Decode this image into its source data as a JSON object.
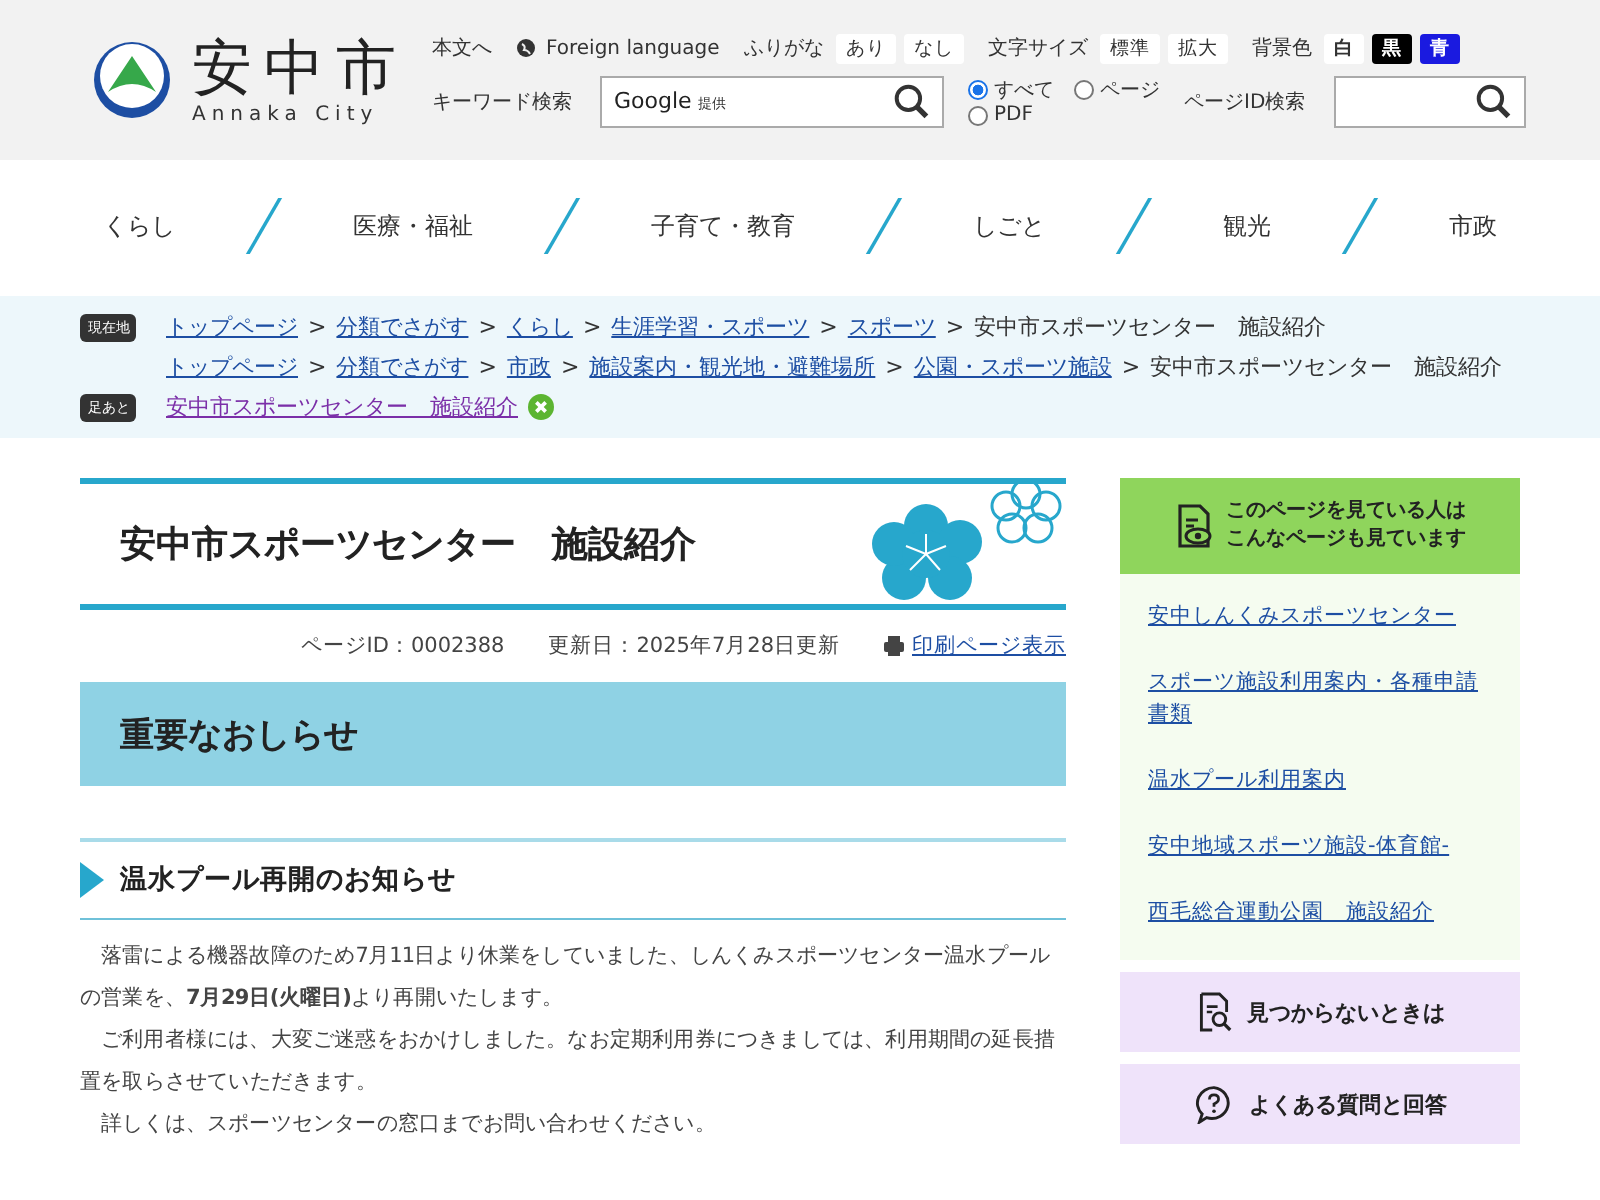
{
  "header": {
    "logo": {
      "name": "安中市",
      "sub": "Annaka City"
    },
    "skip_link": "本文へ",
    "foreign_language": "Foreign language",
    "furigana": {
      "label": "ふりがな",
      "options": [
        {
          "label": "あり",
          "selected": false
        },
        {
          "label": "なし",
          "selected": false
        }
      ]
    },
    "text_size": {
      "label": "文字サイズ",
      "options": [
        {
          "label": "標準",
          "selected": false
        },
        {
          "label": "拡大",
          "selected": false
        }
      ]
    },
    "background": {
      "label": "背景色",
      "options": [
        {
          "label": "白",
          "color": "#ffffff"
        },
        {
          "label": "黒",
          "color": "#000000"
        },
        {
          "label": "青",
          "color": "#1a1ae0"
        }
      ]
    },
    "keyword_search": {
      "label": "キーワード検索",
      "placeholder": "Google",
      "placeholder_sub": "提供",
      "scopes": [
        {
          "label": "すべて",
          "selected": true
        },
        {
          "label": "ページ",
          "selected": false
        },
        {
          "label": "PDF",
          "selected": false
        }
      ]
    },
    "page_id_search": {
      "label": "ページID検索"
    }
  },
  "nav": [
    {
      "label": "くらし"
    },
    {
      "label": "医療・福祉"
    },
    {
      "label": "子育て・教育"
    },
    {
      "label": "しごと"
    },
    {
      "label": "観光"
    },
    {
      "label": "市政"
    }
  ],
  "breadcrumbs": {
    "label": "現在地",
    "separator": ">",
    "trails": [
      {
        "links": [
          "トップページ",
          "分類でさがす",
          "くらし",
          "生涯学習・スポーツ",
          "スポーツ"
        ],
        "current": "安中市スポーツセンター　施設紹介"
      },
      {
        "links": [
          "トップページ",
          "分類でさがす",
          "市政",
          "施設案内・観光地・避難場所",
          "公園・スポーツ施設"
        ],
        "current": "安中市スポーツセンター　施設紹介"
      }
    ]
  },
  "footprints": {
    "label": "足あと",
    "items": [
      "安中市スポーツセンター　施設紹介"
    ]
  },
  "page": {
    "title": "安中市スポーツセンター　施設紹介",
    "page_id": "ページID：0002388",
    "updated": "更新日：2025年7月28日更新",
    "print_link": "印刷ページ表示",
    "notice_heading": "重要なおしらせ",
    "section_heading": "温水プール再開のお知らせ",
    "paragraphs": [
      "落雷による機器故障のため7月11日より休業をしていました、しんくみスポーツセンター温水プールの営業を、**7月29日(火曜日)**より再開いたします。",
      "ご利用者様には、大変ご迷惑をおかけしました。なお定期利用券につきましては、利用期間の延長措置を取らさせていただきます。",
      "詳しくは、スポーツセンターの窓口までお問い合わせください。"
    ]
  },
  "sidebar": {
    "related_heading": [
      "このページを見ている人は",
      "こんなページも見ています"
    ],
    "related_links": [
      "安中しんくみスポーツセンター",
      "スポーツ施設利用案内・各種申請書類",
      "温水プール利用案内",
      "安中地域スポーツ施設-体育館-",
      "西毛総合運動公園　施設紹介"
    ],
    "buttons": [
      {
        "kind": "search",
        "label": "見つからないときは"
      },
      {
        "kind": "faq",
        "label": "よくある質問と回答"
      }
    ]
  }
}
